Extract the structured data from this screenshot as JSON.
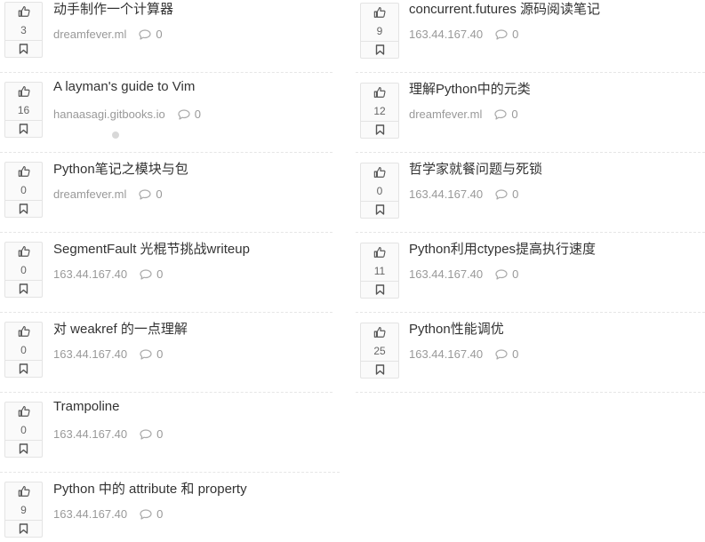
{
  "left_items": [
    {
      "title": "动手制作一个计算器",
      "votes": "3",
      "domain": "dreamfever.ml",
      "comments": "0"
    },
    {
      "title": "A layman's guide to Vim",
      "votes": "16",
      "domain": "hanaasagi.gitbooks.io",
      "comments": "0"
    },
    {
      "title": "Python笔记之模块与包",
      "votes": "0",
      "domain": "dreamfever.ml",
      "comments": "0"
    },
    {
      "title": "SegmentFault 光棍节挑战writeup",
      "votes": "0",
      "domain": "163.44.167.40",
      "comments": "0"
    },
    {
      "title": "对 weakref 的一点理解",
      "votes": "0",
      "domain": "163.44.167.40",
      "comments": "0"
    },
    {
      "title": "Trampoline",
      "votes": "0",
      "domain": "163.44.167.40",
      "comments": "0"
    },
    {
      "title": "Python 中的 attribute 和 property",
      "votes": "9",
      "domain": "163.44.167.40",
      "comments": "0"
    }
  ],
  "right_items": [
    {
      "title": "concurrent.futures 源码阅读笔记",
      "votes": "9",
      "domain": "163.44.167.40",
      "comments": "0"
    },
    {
      "title": "理解Python中的元类",
      "votes": "12",
      "domain": "dreamfever.ml",
      "comments": "0"
    },
    {
      "title": "哲学家就餐问题与死锁",
      "votes": "0",
      "domain": "163.44.167.40",
      "comments": "0"
    },
    {
      "title": "Python利用ctypes提高执行速度",
      "votes": "11",
      "domain": "163.44.167.40",
      "comments": "0"
    },
    {
      "title": "Python性能调优",
      "votes": "25",
      "domain": "163.44.167.40",
      "comments": "0"
    }
  ]
}
